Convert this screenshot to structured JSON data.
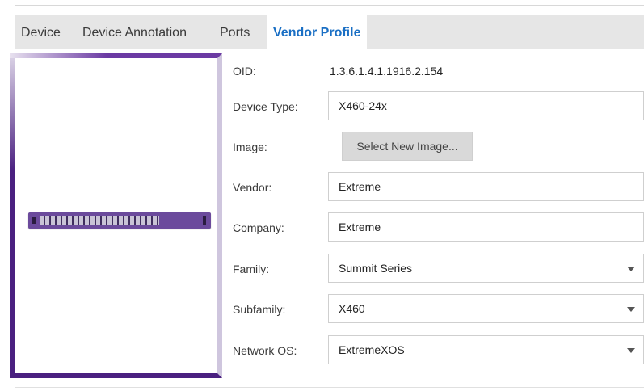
{
  "tabs": [
    {
      "label": "Device"
    },
    {
      "label": "Device Annotation"
    },
    {
      "label": "Ports"
    },
    {
      "label": "Vendor Profile",
      "active": true
    }
  ],
  "form": {
    "oid_label": "OID:",
    "oid_value": "1.3.6.1.4.1.1916.2.154",
    "device_type_label": "Device Type:",
    "device_type_value": "X460-24x",
    "image_label": "Image:",
    "select_image_button": "Select New Image...",
    "vendor_label": "Vendor:",
    "vendor_value": "Extreme",
    "company_label": "Company:",
    "company_value": "Extreme",
    "family_label": "Family:",
    "family_value": "Summit Series",
    "subfamily_label": "Subfamily:",
    "subfamily_value": "X460",
    "network_os_label": "Network OS:",
    "network_os_value": "ExtremeXOS"
  },
  "colors": {
    "active_tab": "#1a6fc4",
    "tab_strip": "#e6e6e6",
    "device_frame": "#5a2e91",
    "switch_body": "#6b4a9c",
    "button_bg": "#d9d9d9"
  },
  "icons": {
    "dropdown": "chevron-down-icon",
    "device_image": "network-switch-image"
  }
}
